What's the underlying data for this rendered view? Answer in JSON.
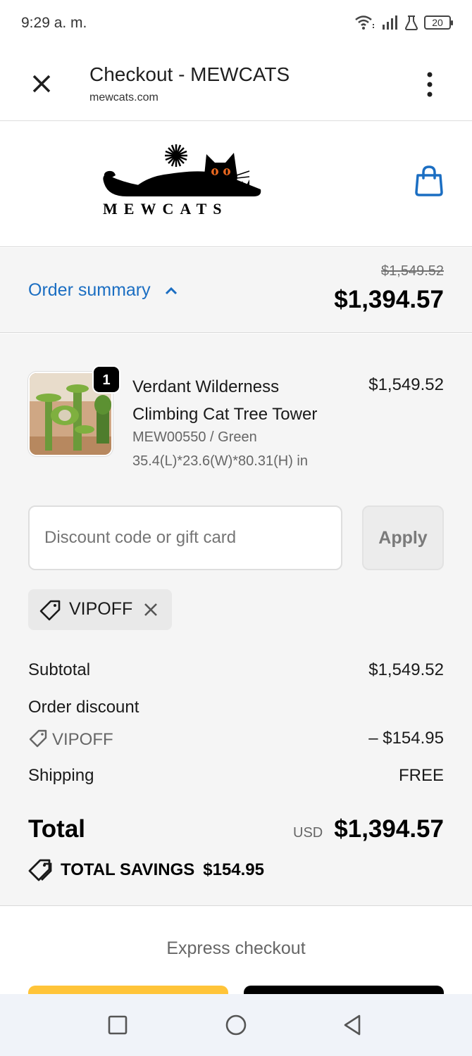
{
  "status_bar": {
    "time": "9:29 a. m.",
    "battery": "20"
  },
  "browser": {
    "title": "Checkout - MEWCATS",
    "url": "mewcats.com"
  },
  "store": {
    "brand": "MEWCATS",
    "accent_color": "#1b6ec2"
  },
  "summary": {
    "label": "Order summary",
    "original_total": "$1,549.52",
    "total": "$1,394.57"
  },
  "product": {
    "quantity": "1",
    "name": "Verdant Wilderness Climbing Cat Tree Tower",
    "variant": "MEW00550 / Green",
    "dimensions": "35.4(L)*23.6(W)*80.31(H) in",
    "price": "$1,549.52"
  },
  "discount": {
    "placeholder": "Discount code or gift card",
    "apply_label": "Apply",
    "applied_code": "VIPOFF"
  },
  "totals": {
    "subtotal_label": "Subtotal",
    "subtotal_value": "$1,549.52",
    "order_discount_label": "Order discount",
    "discount_code": "VIPOFF",
    "discount_value": "– $154.95",
    "shipping_label": "Shipping",
    "shipping_value": "FREE",
    "total_label": "Total",
    "currency": "USD",
    "total_value": "$1,394.57",
    "savings_label": "TOTAL SAVINGS",
    "savings_value": "$154.95"
  },
  "express": {
    "label": "Express checkout"
  }
}
